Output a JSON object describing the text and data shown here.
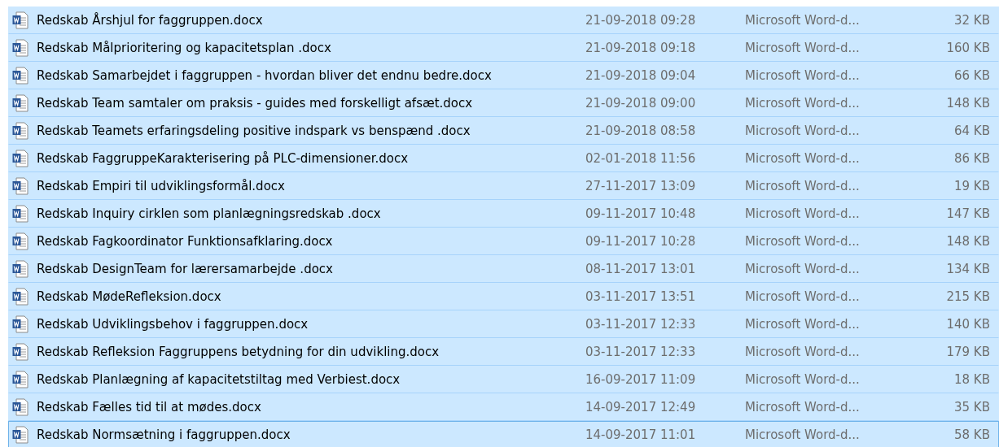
{
  "files": [
    {
      "name": "Redskab Årshjul for faggruppen.docx",
      "modified": "21-09-2018 09:28",
      "type": "Microsoft Word-d...",
      "size": "32 KB",
      "selected": true,
      "focused": false
    },
    {
      "name": "Redskab Målprioritering og kapacitetsplan .docx",
      "modified": "21-09-2018 09:18",
      "type": "Microsoft Word-d...",
      "size": "160 KB",
      "selected": true,
      "focused": false
    },
    {
      "name": "Redskab Samarbejdet i faggruppen - hvordan bliver det endnu bedre.docx",
      "modified": "21-09-2018 09:04",
      "type": "Microsoft Word-d...",
      "size": "66 KB",
      "selected": true,
      "focused": false
    },
    {
      "name": "Redskab Team samtaler om praksis - guides med forskelligt afsæt.docx",
      "modified": "21-09-2018 09:00",
      "type": "Microsoft Word-d...",
      "size": "148 KB",
      "selected": true,
      "focused": false
    },
    {
      "name": "Redskab Teamets erfaringsdeling positive indspark vs benspænd .docx",
      "modified": "21-09-2018 08:58",
      "type": "Microsoft Word-d...",
      "size": "64 KB",
      "selected": true,
      "focused": false
    },
    {
      "name": "Redskab FaggruppeKarakterisering på PLC-dimensioner.docx",
      "modified": "02-01-2018 11:56",
      "type": "Microsoft Word-d...",
      "size": "86 KB",
      "selected": true,
      "focused": false
    },
    {
      "name": "Redskab Empiri til udviklingsformål.docx",
      "modified": "27-11-2017 13:09",
      "type": "Microsoft Word-d...",
      "size": "19 KB",
      "selected": true,
      "focused": false
    },
    {
      "name": "Redskab Inquiry cirklen som planlægningsredskab .docx",
      "modified": "09-11-2017 10:48",
      "type": "Microsoft Word-d...",
      "size": "147 KB",
      "selected": true,
      "focused": false
    },
    {
      "name": "Redskab Fagkoordinator Funktionsafklaring.docx",
      "modified": "09-11-2017 10:28",
      "type": "Microsoft Word-d...",
      "size": "148 KB",
      "selected": true,
      "focused": false
    },
    {
      "name": "Redskab DesignTeam for lærersamarbejde .docx",
      "modified": "08-11-2017 13:01",
      "type": "Microsoft Word-d...",
      "size": "134 KB",
      "selected": true,
      "focused": false
    },
    {
      "name": "Redskab MødeRefleksion.docx",
      "modified": "03-11-2017 13:51",
      "type": "Microsoft Word-d...",
      "size": "215 KB",
      "selected": true,
      "focused": false
    },
    {
      "name": "Redskab Udviklingsbehov i faggruppen.docx",
      "modified": "03-11-2017 12:33",
      "type": "Microsoft Word-d...",
      "size": "140 KB",
      "selected": true,
      "focused": false
    },
    {
      "name": "Redskab Refleksion Faggruppens betydning for din udvikling.docx",
      "modified": "03-11-2017 12:33",
      "type": "Microsoft Word-d...",
      "size": "179 KB",
      "selected": true,
      "focused": false
    },
    {
      "name": "Redskab Planlægning af kapacitetstiltag med Verbiest.docx",
      "modified": "16-09-2017 11:09",
      "type": "Microsoft Word-d...",
      "size": "18 KB",
      "selected": true,
      "focused": false
    },
    {
      "name": "Redskab Fælles tid til at mødes.docx",
      "modified": "14-09-2017 12:49",
      "type": "Microsoft Word-d...",
      "size": "35 KB",
      "selected": true,
      "focused": false
    },
    {
      "name": "Redskab Normsætning i faggruppen.docx",
      "modified": "14-09-2017 11:01",
      "type": "Microsoft Word-d...",
      "size": "58 KB",
      "selected": true,
      "focused": true
    }
  ]
}
